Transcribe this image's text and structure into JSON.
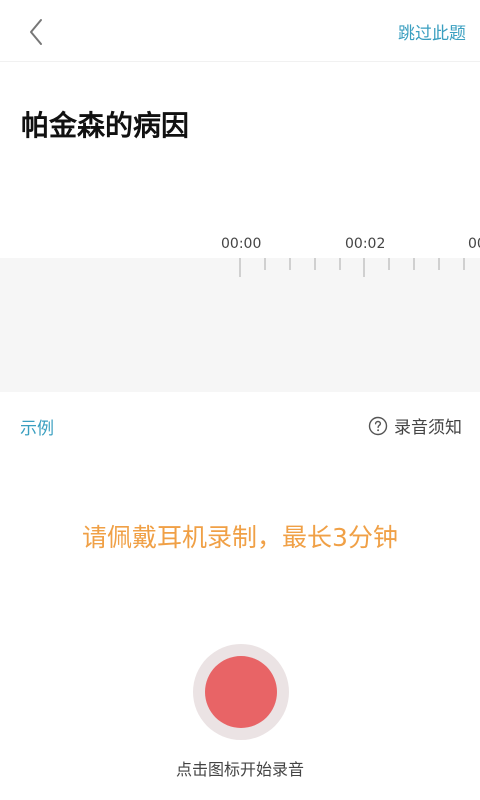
{
  "header": {
    "back_icon": "chevron-left-icon",
    "skip_label": "跳过此题"
  },
  "question": {
    "title": "帕金森的病因"
  },
  "timeline": {
    "labels": [
      "00:00",
      "00:02",
      "00"
    ]
  },
  "links": {
    "example_label": "示例",
    "notice_icon": "question-circle-icon",
    "notice_label": "录音须知"
  },
  "hint": {
    "text": "请佩戴耳机录制，最长3分钟"
  },
  "record": {
    "caption": "点击图标开始录音"
  },
  "colors": {
    "accent_blue": "#3a9fc0",
    "hint_orange": "#f0a046",
    "record_red": "#e86466",
    "record_ring": "#ebe3e4"
  }
}
